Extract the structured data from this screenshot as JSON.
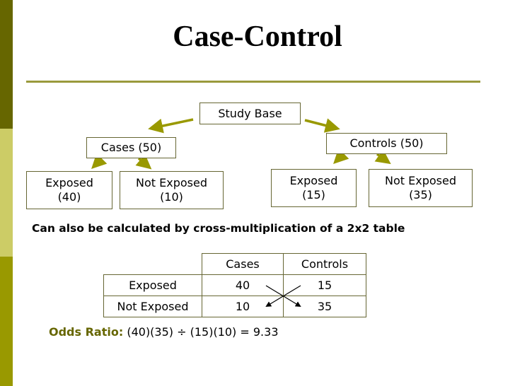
{
  "slide": {
    "title": "Case-Control",
    "colors": {
      "sidebar": [
        "#666600",
        "#cccc66",
        "#999900"
      ],
      "rule": "#9a9a3c",
      "box_border": "#666633",
      "arrow": "#999900",
      "accent_text": "#666600"
    }
  },
  "tree": {
    "root": "Study Base",
    "cases": "Cases (50)",
    "controls": "Controls (50)",
    "cases_exposed": "Exposed\n(40)",
    "cases_not_exposed": "Not Exposed\n(10)",
    "controls_exposed": "Exposed\n(15)",
    "controls_not_exposed": "Not Exposed\n(35)"
  },
  "statement": "Can also be calculated by cross-multiplication of a 2x2 table",
  "table": {
    "headers": [
      "",
      "Cases",
      "Controls"
    ],
    "rows": [
      {
        "label": "Exposed",
        "cases": "40",
        "controls": "15"
      },
      {
        "label": "Not Exposed",
        "cases": "10",
        "controls": "35"
      }
    ]
  },
  "odds_ratio": {
    "label": "Odds Ratio:",
    "formula": " (40)(35) ÷ (15)(10) = 9.33"
  }
}
